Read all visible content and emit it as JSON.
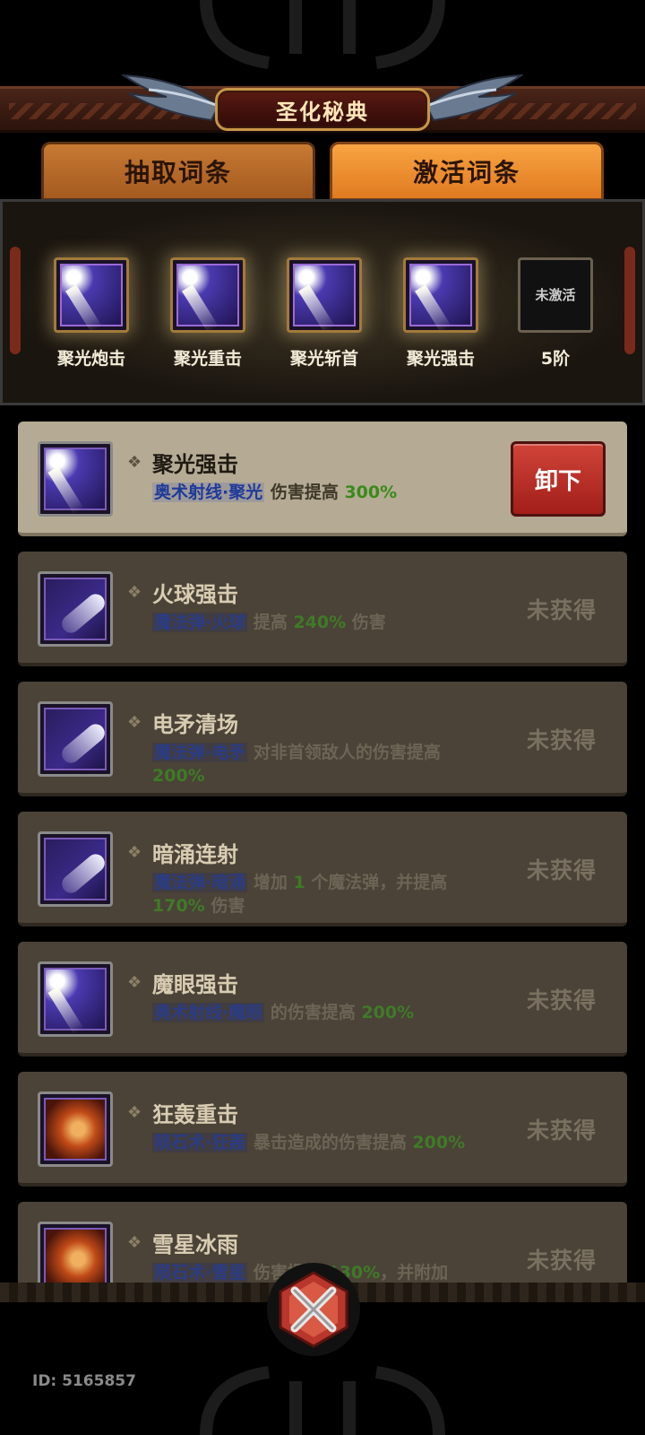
{
  "header": {
    "title": "圣化秘典"
  },
  "tabs": [
    {
      "label": "抽取词条",
      "active": false
    },
    {
      "label": "激活词条",
      "active": true
    }
  ],
  "slots": [
    {
      "label": "聚光炮击",
      "icon": "light-beam-icon"
    },
    {
      "label": "聚光重击",
      "icon": "light-beam-icon"
    },
    {
      "label": "聚光斩首",
      "icon": "light-beam-icon"
    },
    {
      "label": "聚光强击",
      "icon": "light-beam-icon"
    },
    {
      "label": "5阶",
      "icon": "empty-slot",
      "empty_text": "未激活"
    }
  ],
  "entries": [
    {
      "name": "聚光强击",
      "skill": "奥术射线·聚光",
      "desc_a": " 伤害提高 ",
      "num": "300%",
      "desc_b": "",
      "status": "",
      "button": "卸下",
      "icon": "light-beam-icon"
    },
    {
      "name": "火球强击",
      "skill": "魔法弹·火球",
      "desc_a": " 提高 ",
      "num": "240%",
      "desc_b": " 伤害",
      "status": "未获得",
      "icon": "magic-missile-icon"
    },
    {
      "name": "电矛清场",
      "skill": "魔法弹·电矛",
      "desc_a": " 对非首领敌人的伤害提高 ",
      "num": "200%",
      "desc_b": "",
      "status": "未获得",
      "icon": "magic-missile-icon"
    },
    {
      "name": "暗涌连射",
      "skill": "魔法弹·暗涌",
      "desc_a": " 增加 ",
      "num_pre": "1",
      "desc_mid": " 个魔法弹，并提高 ",
      "num": "170%",
      "desc_b": " 伤害",
      "status": "未获得",
      "icon": "magic-missile-icon"
    },
    {
      "name": "魔眼强击",
      "skill": "奥术射线·魔眼",
      "desc_a": " 的伤害提高 ",
      "num": "200%",
      "desc_b": "",
      "status": "未获得",
      "icon": "light-beam-icon"
    },
    {
      "name": "狂轰重击",
      "skill": "陨石术·狂轰",
      "desc_a": " 暴击造成的伤害提高 ",
      "num": "200%",
      "desc_b": "",
      "status": "未获得",
      "icon": "meteor-icon"
    },
    {
      "name": "雪星冰雨",
      "skill": "陨石术·雪星",
      "desc_a": " 伤害提高 ",
      "num": "130%",
      "desc_b": "，并附加",
      "status": "未获得",
      "icon": "meteor-icon"
    }
  ],
  "footer": {
    "id_text": "ID: 5165857"
  },
  "colors": {
    "accent_orange": "#f8a442",
    "unequip_red": "#c2342c",
    "skill_blue": "#2c3c84",
    "num_green": "#3f7a28"
  }
}
